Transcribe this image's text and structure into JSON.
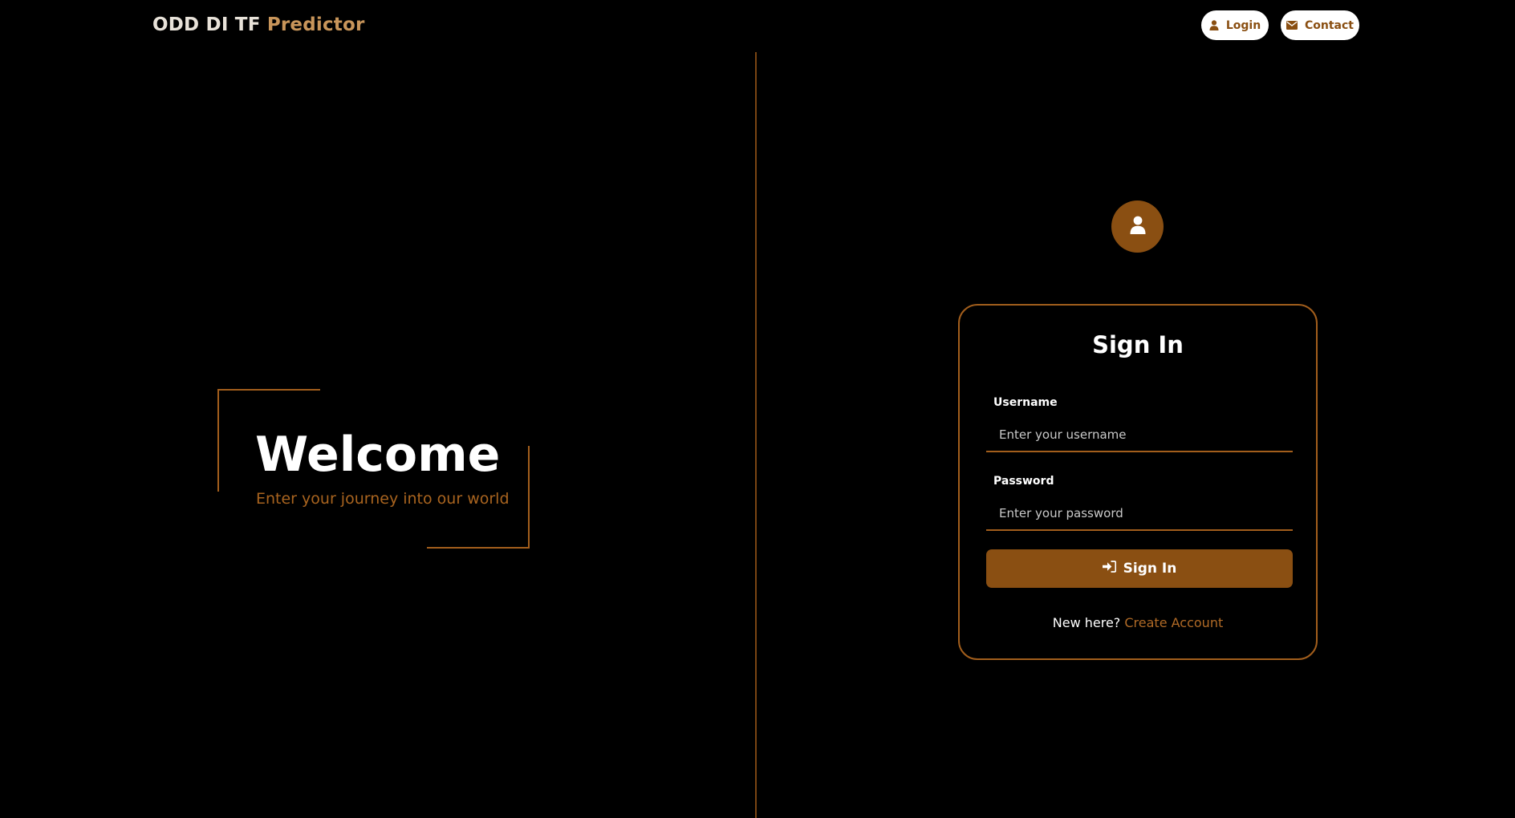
{
  "header": {
    "brand_main": "ODD DI TF",
    "brand_accent": "Predictor",
    "nav": {
      "login_label": "Login",
      "login_icon": "user-icon",
      "contact_label": "Contact",
      "contact_icon": "envelope-icon"
    }
  },
  "hero": {
    "title": "Welcome",
    "subtitle": "Enter your journey into our world"
  },
  "login_card": {
    "avatar_icon": "user-icon",
    "title": "Sign In",
    "username": {
      "label": "Username",
      "value": "",
      "placeholder": "Enter your username"
    },
    "password": {
      "label": "Password",
      "value": "",
      "placeholder": "Enter your password"
    },
    "submit_label": "Sign In",
    "submit_icon": "sign-in-icon",
    "signup_prompt": "New here?",
    "signup_link": "Create Account"
  },
  "colors": {
    "background": "#000000",
    "accent": "#8a4f12",
    "accent_light": "#c8955a",
    "border": "#a25e1c",
    "text": "#ffffff"
  }
}
